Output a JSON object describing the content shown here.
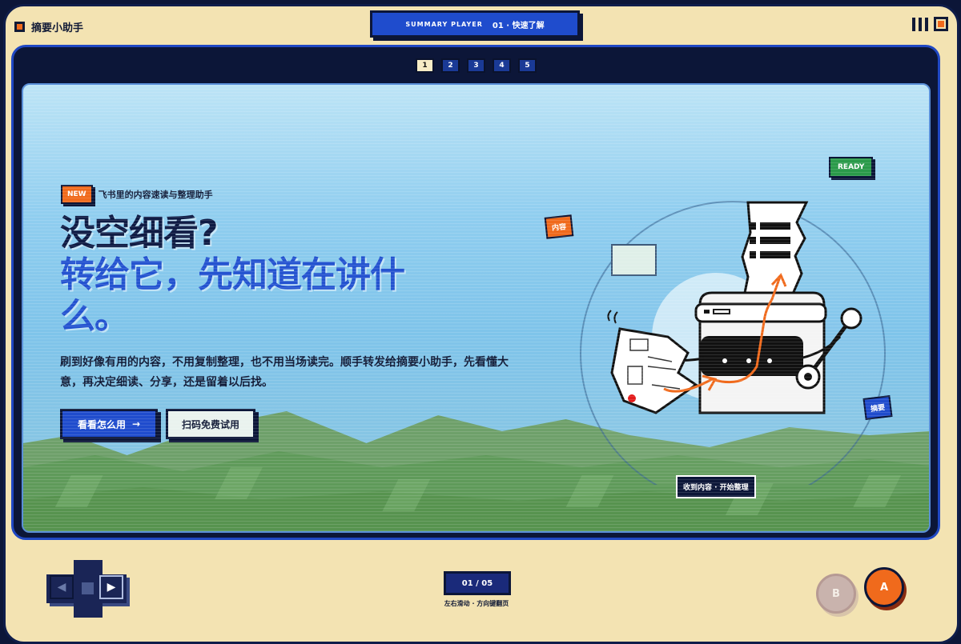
{
  "header": {
    "brand": "摘要小助手",
    "player_label": "SUMMARY PLAYER",
    "episode": "01 · 快速了解"
  },
  "pages": [
    "1",
    "2",
    "3",
    "4",
    "5"
  ],
  "active_page": "1",
  "hero": {
    "new_tag": "NEW",
    "subtitle": "飞书里的内容速读与整理助手",
    "headline_1": "没空细看?",
    "headline_2": "转给它，先知道在讲什么。",
    "description": "刷到好像有用的内容，不用复制整理，也不用当场读完。顺手转发给摘要小助手，先看懂大意，再决定细读、分享，还是留着以后找。",
    "primary_button": "看看怎么用",
    "primary_arrow": "→",
    "secondary_button": "扫码免费试用"
  },
  "illustration": {
    "ready_badge": "READY",
    "content_tag": "内容",
    "summary_tag": "摘要",
    "status": "收到内容 · 开始整理"
  },
  "controls": {
    "counter": "01 / 05",
    "hint": "左右滑动 · 方向键翻页",
    "left_arrow": "◀",
    "right_arrow": "▶",
    "button_b": "B",
    "button_a": "A"
  },
  "colors": {
    "accent_blue": "#1f4ccd",
    "accent_orange": "#f06a1c",
    "navy": "#0c1638",
    "cream": "#f3e3b2",
    "ready_green": "#2a9a4a"
  }
}
